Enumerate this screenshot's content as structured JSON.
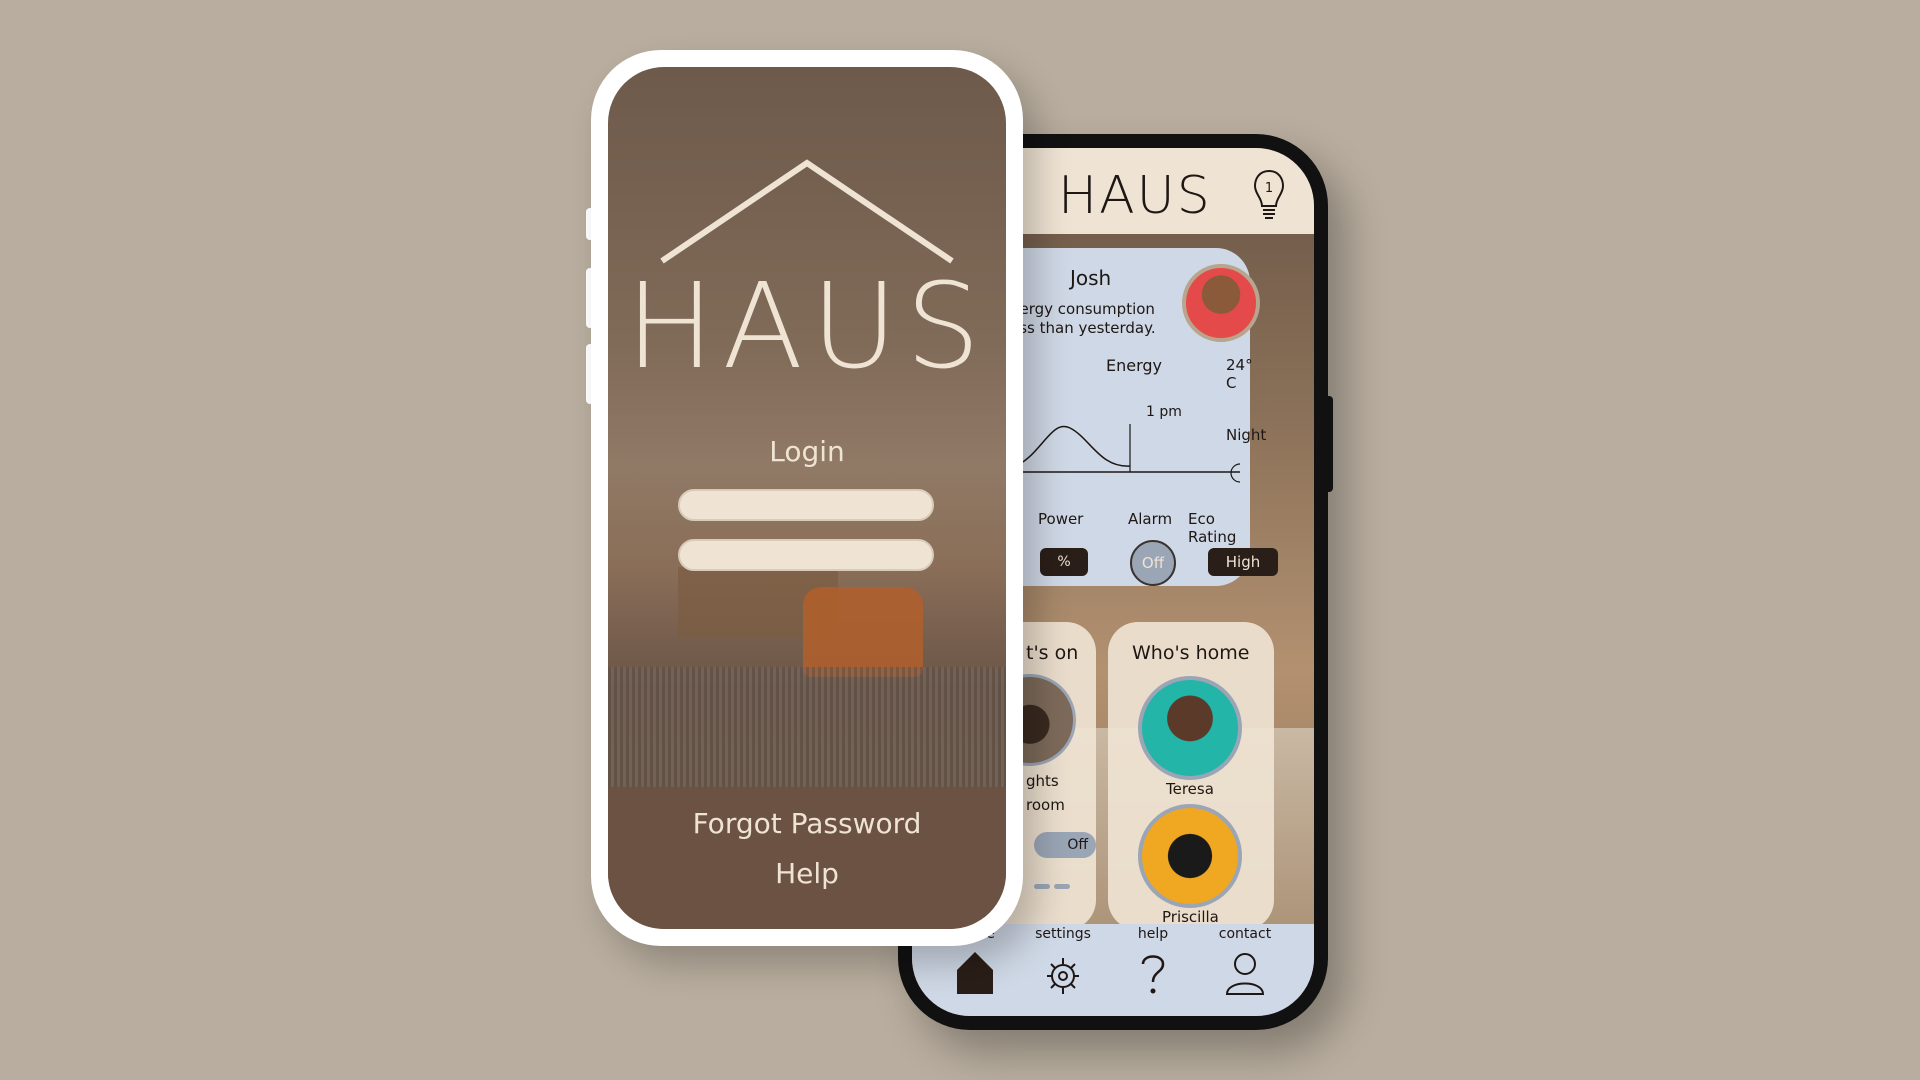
{
  "login_screen": {
    "logo": "HAUS",
    "login_label": "Login",
    "username_placeholder": "",
    "password_placeholder": "",
    "forgot_password": "Forgot Password",
    "help": "Help"
  },
  "dashboard": {
    "brand": "HAUS",
    "notification_count": "1",
    "greeting": "Josh",
    "consumption_line1": "nergy consumption",
    "consumption_line2": "ess than yesterday.",
    "energy_label": "Energy",
    "temperature": "24° C",
    "peak_time": "1 pm",
    "night_label": "Night",
    "power_label": "Power",
    "power_value": "%",
    "alarm_label": "Alarm",
    "alarm_value": "Off",
    "eco_label": "Eco Rating",
    "eco_value": "High",
    "whats_on_title": "t's on",
    "device_line1": "ghts",
    "device_line2": "room",
    "device_toggle": "Off",
    "whos_home_title": "Who's home",
    "people": [
      {
        "name": "Teresa"
      },
      {
        "name": "Priscilla"
      }
    ],
    "nav": [
      {
        "label": "home",
        "icon": "home-icon"
      },
      {
        "label": "settings",
        "icon": "gear-icon"
      },
      {
        "label": "help",
        "icon": "question-icon"
      },
      {
        "label": "contact",
        "icon": "user-icon"
      }
    ]
  },
  "colors": {
    "background": "#b8ad9e",
    "cream": "#efe3d3",
    "card_blue": "#cfd8e6",
    "dark": "#2a1e18"
  }
}
